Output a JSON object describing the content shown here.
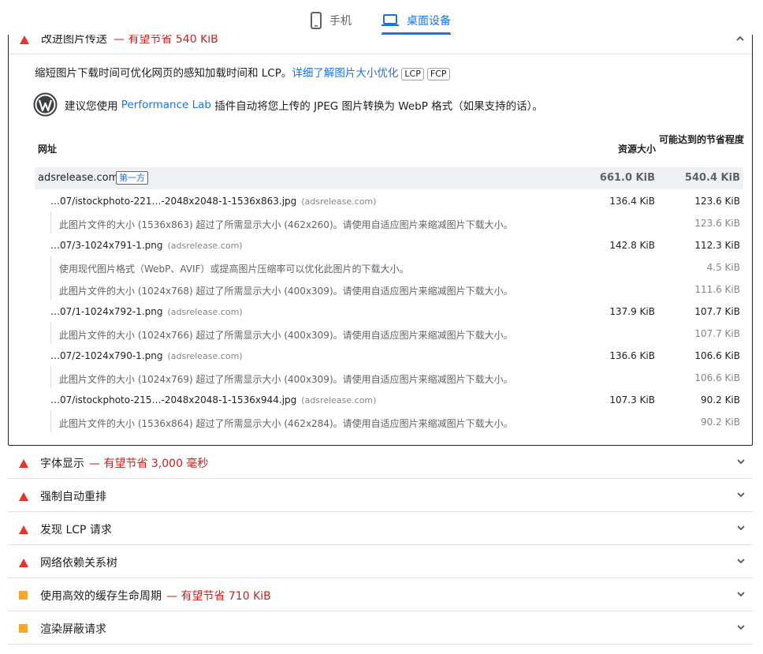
{
  "tabs": {
    "mobile_label": "手机",
    "desktop_label": "桌面设备",
    "active": "desktop"
  },
  "colors": {
    "accent": "#1a73e8",
    "fail": "#e8332a",
    "average": "#f9a825",
    "savings_text": "#c5221f"
  },
  "expanded_audit": {
    "title": "改进图片传送",
    "savings": "— 有望节省 540 KiB",
    "description": "缩短图片下载时间可优化网页的感知加载时间和 LCP。",
    "learn_more": "详细了解图片大小优化",
    "tags": [
      "LCP",
      "FCP"
    ],
    "wp_prefix": "建议您使用",
    "wp_link": "Performance Lab",
    "wp_suffix": "插件自动将您上传的 JPEG 图片转换为 WebP 格式（如果支持的话）。",
    "icons": {
      "wordpress": "wordpress-icon",
      "status": "triangle-fail-icon",
      "collapse": "chevron-up-icon"
    },
    "table": {
      "headers": {
        "url": "网址",
        "size": "资源大小",
        "savings": "可能达到的节省程度"
      },
      "group": {
        "name": "adsrelease.com",
        "badge": "第一方",
        "size": "661.0 KiB",
        "savings": "540.4 KiB"
      },
      "rows": [
        {
          "type": "item",
          "url": "…07/istockphoto-221…-2048x2048-1-1536x863.jpg",
          "domain": "(adsrelease.com)",
          "size": "136.4 KiB",
          "savings": "123.6 KiB"
        },
        {
          "type": "sub",
          "msg": "此图片文件的大小 (1536x863) 超过了所需显示大小 (462x260)。请使用自适应图片来缩减图片下载大小。",
          "savings": "123.6 KiB"
        },
        {
          "type": "item",
          "url": "…07/3-1024x791-1.png",
          "domain": "(adsrelease.com)",
          "size": "142.8 KiB",
          "savings": "112.3 KiB"
        },
        {
          "type": "sub",
          "msg": "使用现代图片格式（WebP、AVIF）或提高图片压缩率可以优化此图片的下载大小。",
          "savings": "4.5 KiB"
        },
        {
          "type": "sub",
          "msg": "此图片文件的大小 (1024x768) 超过了所需显示大小 (400x309)。请使用自适应图片来缩减图片下载大小。",
          "savings": "111.6 KiB"
        },
        {
          "type": "item",
          "url": "…07/1-1024x792-1.png",
          "domain": "(adsrelease.com)",
          "size": "137.9 KiB",
          "savings": "107.7 KiB"
        },
        {
          "type": "sub",
          "msg": "此图片文件的大小 (1024x766) 超过了所需显示大小 (400x309)。请使用自适应图片来缩减图片下载大小。",
          "savings": "107.7 KiB"
        },
        {
          "type": "item",
          "url": "…07/2-1024x790-1.png",
          "domain": "(adsrelease.com)",
          "size": "136.6 KiB",
          "savings": "106.6 KiB"
        },
        {
          "type": "sub",
          "msg": "此图片文件的大小 (1024x769) 超过了所需显示大小 (400x309)。请使用自适应图片来缩减图片下载大小。",
          "savings": "106.6 KiB"
        },
        {
          "type": "item",
          "url": "…07/istockphoto-215…-2048x2048-1-1536x944.jpg",
          "domain": "(adsrelease.com)",
          "size": "107.3 KiB",
          "savings": "90.2 KiB"
        },
        {
          "type": "sub",
          "msg": "此图片文件的大小 (1536x864) 超过了所需显示大小 (462x284)。请使用自适应图片来缩减图片下载大小。",
          "savings": "90.2 KiB"
        }
      ]
    }
  },
  "audits": [
    {
      "title": "字体显示",
      "savings": "— 有望节省 3,000 毫秒",
      "status": "fail",
      "icon": "triangle-fail-icon"
    },
    {
      "title": "强制自动重排",
      "savings": "",
      "status": "fail",
      "icon": "triangle-fail-icon"
    },
    {
      "title": "发现 LCP 请求",
      "savings": "",
      "status": "fail",
      "icon": "triangle-fail-icon"
    },
    {
      "title": "网络依赖关系树",
      "savings": "",
      "status": "fail",
      "icon": "triangle-fail-icon"
    },
    {
      "title": "使用高效的缓存生命周期",
      "savings": "— 有望节省 710 KiB",
      "status": "average",
      "icon": "square-average-icon"
    },
    {
      "title": "渲染屏蔽请求",
      "savings": "",
      "status": "average",
      "icon": "square-average-icon"
    }
  ]
}
